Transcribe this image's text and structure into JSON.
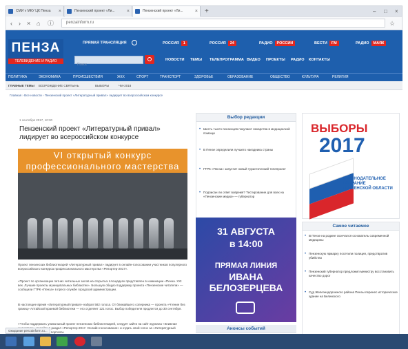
{
  "browser": {
    "tabs": [
      {
        "label": "СМИ v МКУ ЦК Пенза"
      },
      {
        "label": "Пензенский проект «Ли..."
      },
      {
        "label": "Пензенский проект «Ли..."
      }
    ],
    "url": "penzainform.ru",
    "status_text": "Ожидание penzainform.ru..."
  },
  "site": {
    "logo": "ПЕНЗА",
    "logo_sub": "ТЕЛЕВИДЕНИЕ И РАДИО",
    "header_links": [
      {
        "label": "ПРЯМАЯ ТРАНСЛЯЦИЯ",
        "badge": ""
      },
      {
        "label": "РОССИЯ",
        "badge": "1"
      },
      {
        "label": "РОССИЯ",
        "badge": "24"
      },
      {
        "label": "РАДИО",
        "badge": "РОССИИ"
      },
      {
        "label": "ВЕСТИ",
        "badge": "FM"
      },
      {
        "label": "РАДИО",
        "badge": "МАЯК"
      }
    ],
    "search_placeholder": "Поиск",
    "top_menu": [
      "НОВОСТИ",
      "ТЕМЫ",
      "ТЕЛЕПРОГРАММА",
      "ВИДЕО",
      "ПРОЕКТЫ",
      "РАДИО",
      "КОНТАКТЫ"
    ],
    "categories": [
      "ПОЛИТИКА",
      "ЭКОНОМИКА",
      "ПРОИСШЕСТВИЯ",
      "ЖКХ",
      "СПОРТ",
      "ТРАНСПОРТ",
      "ЗДОРОВЬЕ",
      "ОБРАЗОВАНИЕ",
      "ОБЩЕСТВО",
      "КУЛЬТУРА",
      "РЕЛИГИЯ"
    ],
    "subnav": [
      "ГЛАВНЫЕ ТЕМЫ",
      "ВОЗРОЖДЕНИЕ СВЯТЫНЬ",
      "ВЫБОРЫ",
      "ЧМ-2018"
    ],
    "breadcrumb": "Главная › Все новости › Пензенский проект «Литературный привал» лидирует во всероссийском конкурсе"
  },
  "article": {
    "date": "1 сентября 2017, 10:30",
    "title": "Пензенский проект «Литературный привал» лидирует во всероссийском конкурсе",
    "contest_line1": "VI открытый конкурс",
    "contest_line2": "профессионального мастерства",
    "p1": "Проект пензенских библиотекарей «Литературный привал» лидирует в онлайн-голосовании участников популярного всероссийского конкурса профессионального мастерства «Репортер-2017».",
    "p2": "«Проект по организации летних читальных залов на открытых площадках представлен в номинации «Пенза. XXI век. Лучшие проекты муниципальных библиотек». Большую общую поддержку проекта «Пензенские читатели» — сообщили ГТРК «Пенза» в пресс-службе городской администрации.",
    "p3": "В настоящее время «Литературный привал» набрал 582 голоса. От ближайшего соперника — проекта «Чтение без границ» Алтайской краевой библиотеки — его отделяет 121 голос. Выбор победителя продлится до 30 сентября.",
    "p4": "«Чтобы поддержать уникальный проект пензенских библиотекарей, следует зайти на сайт журнала «Книжная индустрия», перейти в раздел «Репортер-2017. Онлайн-голосование» и отдать свой голос за «Литературный привал» на страницах портала»"
  },
  "editors_choice": {
    "title": "Выбор редакции",
    "items": [
      "Шесть тысяч пензенцев покупают лекарства в медицинской помощи",
      "В Пензе определили лучшего наездника страны",
      "ГТРК «Пенза» запустит новый туристический телепроект",
      "Подписан ли ответ вовремя? Тестирование для всех на «Пензенские медиа» — губернатор"
    ]
  },
  "live_banner": {
    "date": "31 АВГУСТА",
    "time": "в 14:00",
    "line1": "ПРЯМАЯ ЛИНИЯ",
    "line2": "ИВАНА",
    "line3": "БЕЛОЗЕРЦЕВА"
  },
  "elections": {
    "title": "ВЫБОРЫ",
    "year": "2017",
    "subtitle": "ЗАКОНОДАТЕЛЬНОЕ СОБРАНИЕ ПЕНЗЕНСКОЙ ОБЛАСТИ"
  },
  "most_read": {
    "title": "Самое читаемое",
    "items": [
      "В Пензе на родине скончался основатель современной медицины",
      "Пензенскую ярмарку посетили полиция, предотвратив убийство",
      "Пензенский губернатор предложил министру восстановить качество дорог",
      "Суд Железнодорожного района Пензы перенес историческое здание на Белинского"
    ]
  },
  "announcements": {
    "title": "Анонсы событий"
  }
}
